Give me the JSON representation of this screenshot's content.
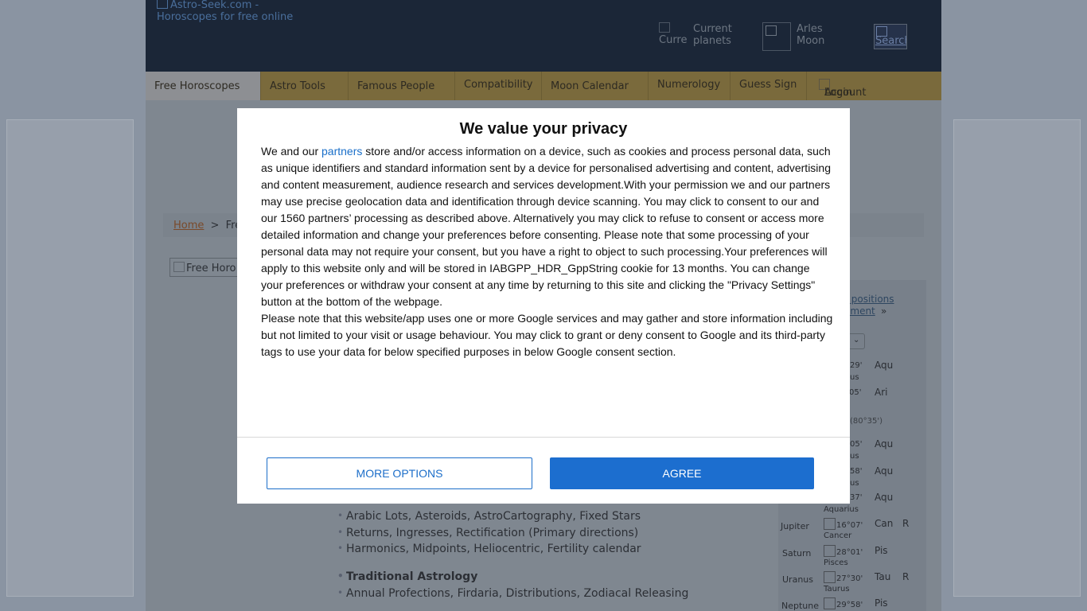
{
  "header": {
    "logo_alt": "Astro-Seek.com - Horoscopes for free online",
    "current_planets_img_alt": "Curre",
    "current_planets_label": "Current planets",
    "moon_label": "Arles Moon",
    "search_alt": "Search"
  },
  "nav": {
    "items": [
      {
        "label": "Free Horoscopes"
      },
      {
        "label": "Astro Tools"
      },
      {
        "label": "Famous People"
      },
      {
        "label": "Compatibility"
      },
      {
        "label": "Moon Calendar"
      },
      {
        "label": "Numerology"
      },
      {
        "label": "Guess Sign"
      },
      {
        "label": "Account"
      }
    ],
    "login_label": "Login"
  },
  "breadcrumb": {
    "home": "Home",
    "separator": ">",
    "current": "Fre"
  },
  "free_image_alt": "Free Horo",
  "side_panel": {
    "link_positions": "r positions",
    "link_element": "ement",
    "link_arrow": "»",
    "rows": [
      {
        "planet": "",
        "degree": "29'",
        "sign_full": "us",
        "sign": "Aqu",
        "retro": ""
      },
      {
        "planet": "",
        "degree": "°05'",
        "sign_full": "",
        "sign": "Ari",
        "retro": ""
      },
      {
        "planet": "",
        "degree": "(80°35')",
        "sign_full": "",
        "sign": "",
        "retro": ""
      },
      {
        "planet": "",
        "degree": "05'",
        "sign_full": "us",
        "sign": "Aqu",
        "retro": ""
      },
      {
        "planet": "",
        "degree": "58'",
        "sign_full": "us",
        "sign": "Aqu",
        "retro": ""
      },
      {
        "planet": "",
        "degree": "37'",
        "sign_full": "Aquarius",
        "sign": "Aqu",
        "retro": ""
      },
      {
        "planet": "Jupiter",
        "degree": "16°07'",
        "sign_full": "Cancer",
        "sign": "Can",
        "retro": "R"
      },
      {
        "planet": "Saturn",
        "degree": "28°01'",
        "sign_full": "Pisces",
        "sign": "Pis",
        "retro": ""
      },
      {
        "planet": "Uranus",
        "degree": "27°30'",
        "sign_full": "Taurus",
        "sign": "Tau",
        "retro": "R"
      },
      {
        "planet": "Neptune",
        "degree": "29°58'",
        "sign_full": "",
        "sign": "Pis",
        "retro": ""
      }
    ]
  },
  "content": {
    "lines": [
      "Arabic Lots, Asteroids, AstroCartography, Fixed Stars",
      "Returns, Ingresses, Rectification (Primary directions)",
      "Harmonics, Midpoints, Heliocentric, Fertility calendar"
    ],
    "traditional_heading": "Traditional Astrology",
    "traditional_line": "Annual Profections, Firdaria, Distributions, Zodiacal Releasing"
  },
  "consent": {
    "title": "We value your privacy",
    "p1_before_link": "We and our ",
    "p1_link": "partners",
    "p1_after_link": " store and/or access information on a device, such as cookies and process personal data, such as unique identifiers and standard information sent by a device for personalised advertising and content, advertising and content measurement, audience research and services development.With your permission we and our partners may use precise geolocation data and identification through device scanning. You may click to consent to our and our 1560 partners’ processing as described above. Alternatively you may click to refuse to consent or access more detailed information and change your preferences before consenting. Please note that some processing of your personal data may not require your consent, but you have a right to object to such processing.Your preferences will apply to this website only and will be stored in IABGPP_HDR_GppString cookie for 13 months. You can change your preferences or withdraw your consent at any time by returning to this site and clicking the \"Privacy Settings\" button at the bottom of the webpage.",
    "p2": "Please note that this website/app uses one or more Google services and may gather and store information including but not limited to your visit or usage behaviour. You may click to grant or deny consent to Google and its third-party tags to use your data for below specified purposes in below Google consent section.",
    "more_options_label": "MORE OPTIONS",
    "agree_label": "AGREE"
  }
}
